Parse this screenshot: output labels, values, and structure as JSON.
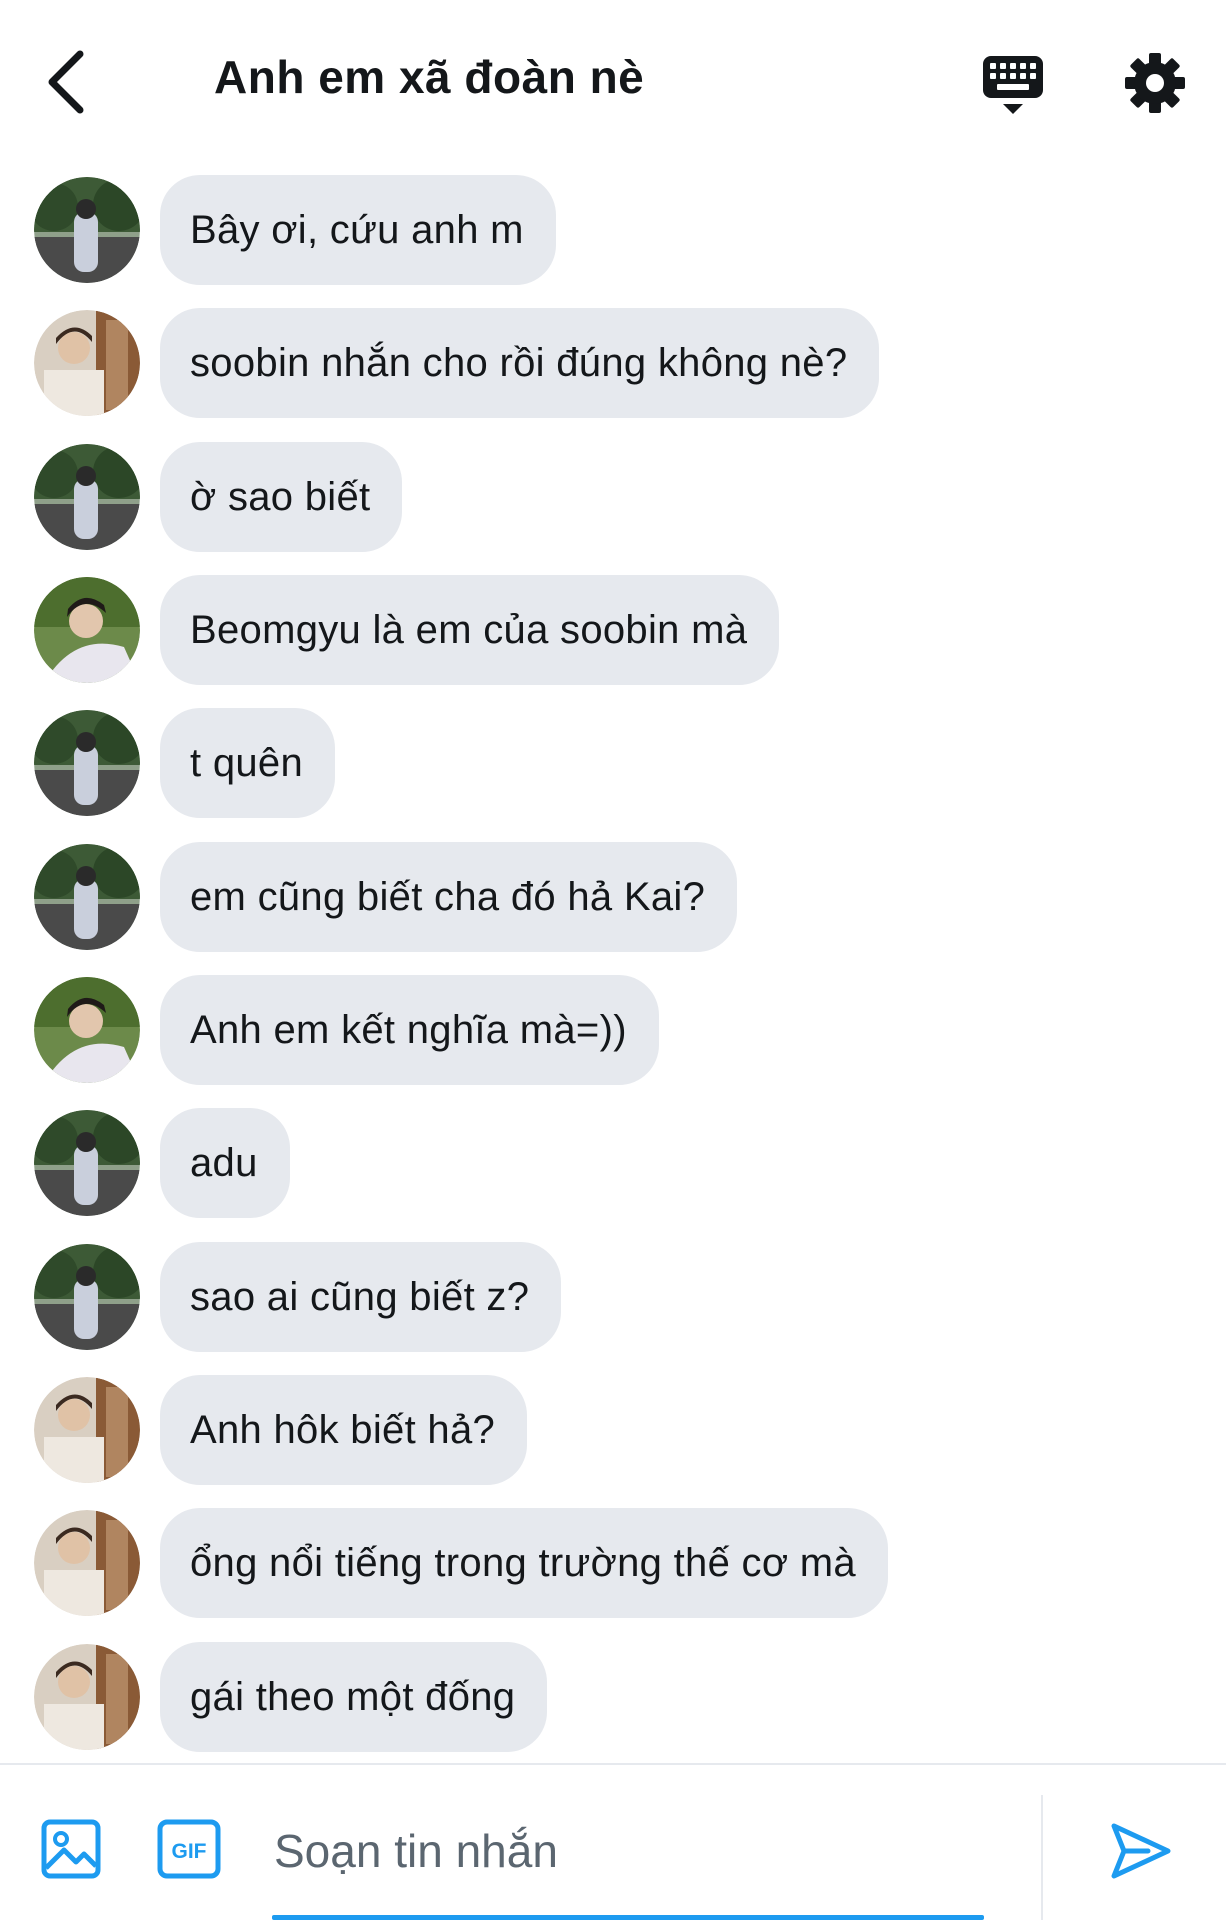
{
  "header": {
    "title": "Anh em xã đoàn nè",
    "back_icon": "chevron-left-icon",
    "keyboard_icon": "keyboard-icon",
    "settings_icon": "gear-icon"
  },
  "messages": [
    {
      "avatar": "boy-in-park",
      "text": "Bây ơi, cứu anh m"
    },
    {
      "avatar": "boy-with-window",
      "text": "soobin nhắn cho rồi đúng không nè?"
    },
    {
      "avatar": "boy-in-park",
      "text": "ờ sao biết"
    },
    {
      "avatar": "boy-in-hoodie",
      "text": "Beomgyu là em của soobin mà"
    },
    {
      "avatar": "boy-in-park",
      "text": "t quên"
    },
    {
      "avatar": "boy-in-park",
      "text": "em cũng biết cha đó hả Kai?"
    },
    {
      "avatar": "boy-in-hoodie",
      "text": "Anh em kết nghĩa mà=))"
    },
    {
      "avatar": "boy-in-park",
      "text": "adu"
    },
    {
      "avatar": "boy-in-park",
      "text": "sao ai cũng biết z?"
    },
    {
      "avatar": "boy-with-window",
      "text": "Anh hôk biết hả?"
    },
    {
      "avatar": "boy-with-window",
      "text": "ổng nổi tiếng trong trường thế cơ mà"
    },
    {
      "avatar": "boy-with-window",
      "text": "gái theo một đống"
    }
  ],
  "composer": {
    "placeholder": "Soạn tin nhắn",
    "gif_label": "GIF",
    "image_icon": "image-icon",
    "send_icon": "send-icon"
  },
  "colors": {
    "bubble": "#e6e9ee",
    "accent": "#1d9bf0",
    "text": "#14171a",
    "placeholder": "#5b6670"
  }
}
